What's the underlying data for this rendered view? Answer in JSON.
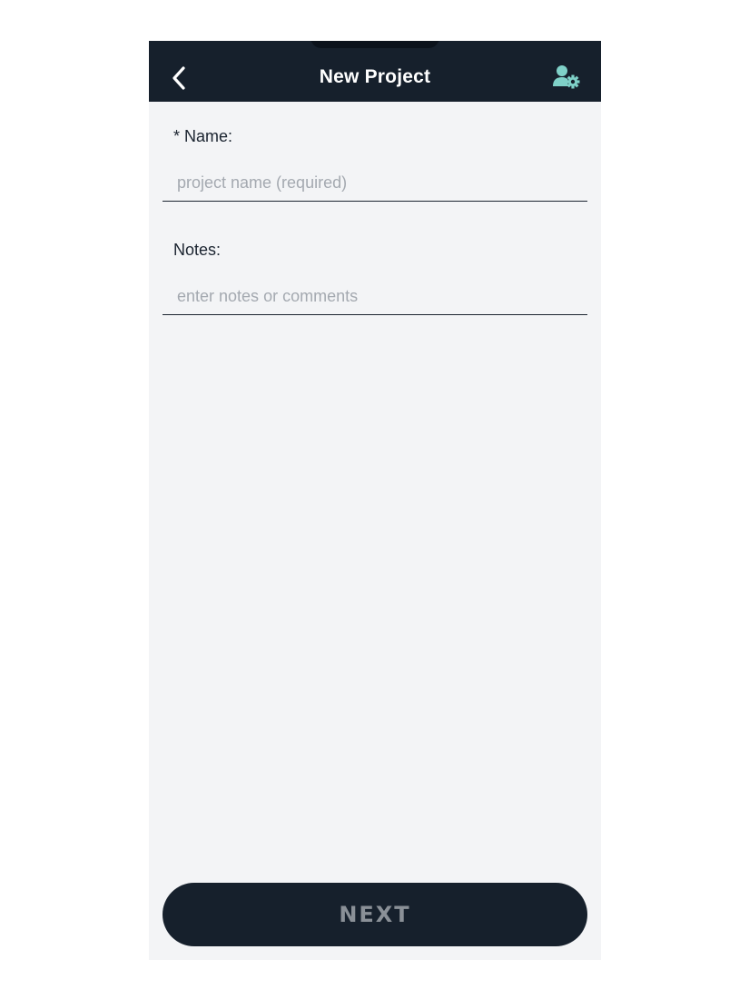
{
  "header": {
    "title": "New Project",
    "back_icon": "chevron-left-icon",
    "settings_icon": "user-settings-icon",
    "background": "#16202c",
    "accent": "#7fd1c8"
  },
  "form": {
    "name": {
      "label": "* Name:",
      "placeholder": "project name (required)",
      "value": ""
    },
    "notes": {
      "label": "Notes:",
      "placeholder": "enter notes or comments",
      "value": ""
    }
  },
  "footer": {
    "next_label": "NEXT"
  },
  "colors": {
    "page_background": "#f3f4f6",
    "button_background": "#16202c",
    "button_text_disabled": "#8a9097",
    "placeholder": "#a4a9b0"
  }
}
